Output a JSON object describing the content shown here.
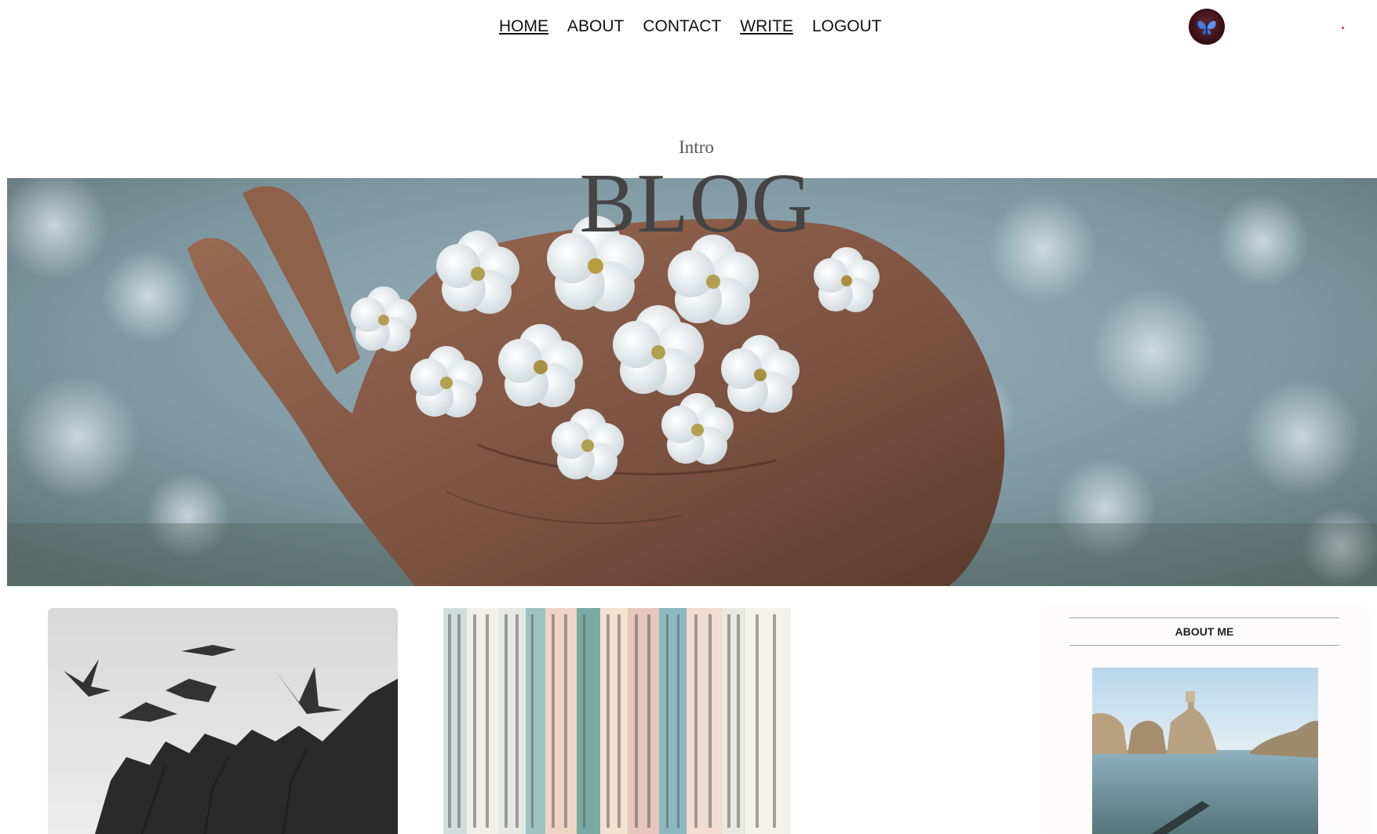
{
  "nav": {
    "items": [
      {
        "label": "HOME",
        "underlined": true
      },
      {
        "label": "ABOUT",
        "underlined": false
      },
      {
        "label": "CONTACT",
        "underlined": false
      },
      {
        "label": "WRITE",
        "underlined": true
      },
      {
        "label": "LOGOUT",
        "underlined": false
      }
    ]
  },
  "header": {
    "subtitle": "Intro",
    "title": "BLOG"
  },
  "sidebar": {
    "title": "ABOUT ME"
  },
  "icons": {
    "profile": "profile-avatar",
    "status_dot": "status-dot-icon"
  },
  "colors": {
    "text": "#111111",
    "title": "#444444",
    "accent_dot": "#c0392b"
  }
}
